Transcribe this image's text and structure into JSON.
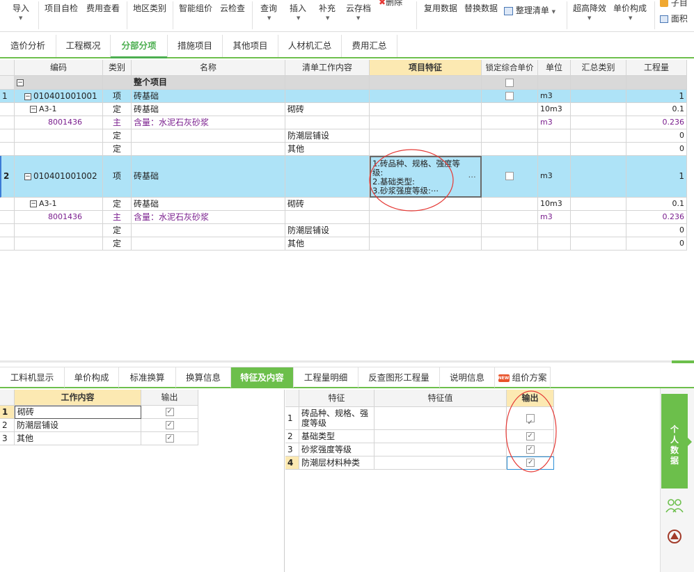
{
  "toolbar": {
    "items": [
      {
        "label": "导入",
        "arrow": true
      },
      {
        "label": "项目自检"
      },
      {
        "label": "费用查看"
      },
      {
        "label": "地区类别"
      },
      {
        "label": "智能组价"
      },
      {
        "label": "云检查"
      },
      {
        "label": "查询",
        "arrow": true
      },
      {
        "label": "插入",
        "arrow": true
      },
      {
        "label": "补充",
        "arrow": true
      },
      {
        "label": "云存档",
        "arrow": true
      },
      {
        "label": "删除"
      },
      {
        "label": "复用数据"
      },
      {
        "label": "替换数据"
      },
      {
        "label": "整理清单",
        "arrow": true
      },
      {
        "label": "超高降效",
        "arrow": true
      },
      {
        "label": "单价构成",
        "arrow": true
      },
      {
        "label": "子目"
      },
      {
        "label": "面积"
      }
    ]
  },
  "main_tabs": [
    "造价分析",
    "工程概况",
    "分部分项",
    "措施项目",
    "其他项目",
    "人材机汇总",
    "费用汇总"
  ],
  "main_active_tab": "分部分项",
  "grid": {
    "headers": [
      "编码",
      "类别",
      "名称",
      "清单工作内容",
      "项目特征",
      "锁定综合单价",
      "单位",
      "汇总类别",
      "工程量"
    ],
    "whole_project": "整个项目",
    "rows": [
      {
        "no": "1",
        "code": "010401001001",
        "type": "项",
        "name": "砖基础",
        "work": "",
        "feature": "",
        "lock": true,
        "unit": "m3",
        "qty": "1"
      },
      {
        "no": "",
        "code": "A3-1",
        "type": "定",
        "name": "砖基础",
        "work": "砌砖",
        "feature": "",
        "unit": "10m3",
        "qty": "0.1"
      },
      {
        "no": "",
        "code": "8001436",
        "type": "主",
        "name": "含量：水泥石灰砂浆",
        "work": "",
        "feature": "",
        "unit": "m3",
        "qty": "0.236"
      },
      {
        "no": "",
        "code": "",
        "type": "定",
        "name": "",
        "work": "防潮层铺设",
        "feature": "",
        "unit": "",
        "qty": "0"
      },
      {
        "no": "",
        "code": "",
        "type": "定",
        "name": "",
        "work": "其他",
        "feature": "",
        "unit": "",
        "qty": "0"
      },
      {
        "no": "2",
        "code": "010401001002",
        "type": "项",
        "name": "砖基础",
        "work": "",
        "feature_lines": [
          "1.砖品种、规格、强度等",
          "级:",
          "2.基础类型:",
          "3.砂浆强度等级:⋯"
        ],
        "feature_more": "⋯",
        "lock": true,
        "unit": "m3",
        "qty": "1"
      },
      {
        "no": "",
        "code": "A3-1",
        "type": "定",
        "name": "砖基础",
        "work": "砌砖",
        "feature": "",
        "unit": "10m3",
        "qty": "0.1"
      },
      {
        "no": "",
        "code": "8001436",
        "type": "主",
        "name": "含量：水泥石灰砂浆",
        "work": "",
        "feature": "",
        "unit": "m3",
        "qty": "0.236"
      },
      {
        "no": "",
        "code": "",
        "type": "定",
        "name": "",
        "work": "防潮层铺设",
        "feature": "",
        "unit": "",
        "qty": "0"
      },
      {
        "no": "",
        "code": "",
        "type": "定",
        "name": "",
        "work": "其他",
        "feature": "",
        "unit": "",
        "qty": "0"
      }
    ]
  },
  "bottom_tabs": [
    "工料机显示",
    "单价构成",
    "标准换算",
    "换算信息",
    "特征及内容",
    "工程量明细",
    "反查图形工程量",
    "说明信息",
    "组价方案"
  ],
  "bottom_active_tab": "特征及内容",
  "new_badge": "NEW",
  "work_table": {
    "headers": [
      "工作内容",
      "输出"
    ],
    "rows": [
      {
        "no": "1",
        "content": "砌砖",
        "output": true
      },
      {
        "no": "2",
        "content": "防潮层铺设",
        "output": true
      },
      {
        "no": "3",
        "content": "其他",
        "output": true
      }
    ]
  },
  "feature_table": {
    "headers": [
      "特征",
      "特征值",
      "输出"
    ],
    "rows": [
      {
        "no": "1",
        "feature_lines": [
          "砖品种、规格、强",
          "度等级"
        ],
        "value": "",
        "output": true
      },
      {
        "no": "2",
        "feature": "基础类型",
        "value": "",
        "output": true
      },
      {
        "no": "3",
        "feature": "砂浆强度等级",
        "value": "",
        "output": true
      },
      {
        "no": "4",
        "feature": "防潮层材料种类",
        "value": "",
        "output": true
      }
    ]
  },
  "side_panel": {
    "label_lines": [
      "个",
      "人",
      "数",
      "据"
    ]
  },
  "colors": {
    "accent_green": "#6cbf4b",
    "row_highlight": "#aee3f7",
    "header_selected": "#fce9b2",
    "annotation_red": "#e53935",
    "main_material": "#7a1e8e"
  }
}
